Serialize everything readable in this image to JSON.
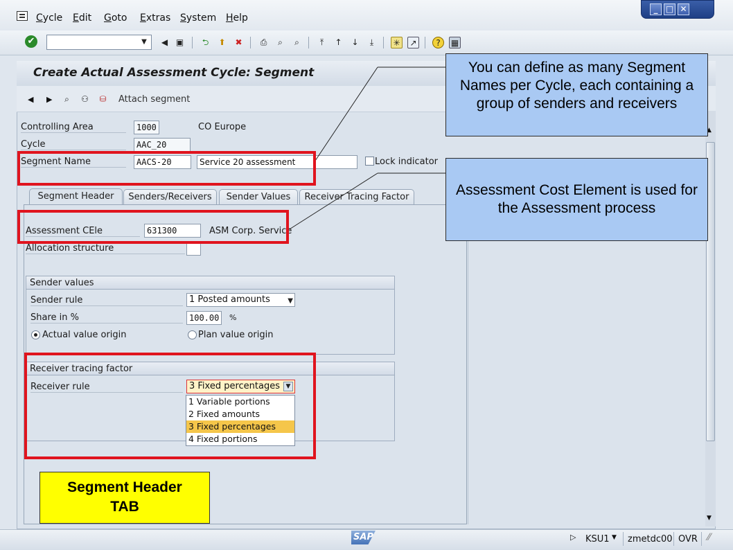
{
  "menubar": {
    "items": [
      "Cycle",
      "Edit",
      "Goto",
      "Extras",
      "System",
      "Help"
    ]
  },
  "window_controls": [
    "_",
    "□",
    "✕"
  ],
  "toolbar": {
    "command_field_value": ""
  },
  "page": {
    "title": "Create Actual Assessment Cycle: Segment",
    "attach_segment": "Attach segment"
  },
  "header_fields": {
    "controlling_area": {
      "label": "Controlling Area",
      "value": "1000",
      "text": "CO Europe"
    },
    "cycle": {
      "label": "Cycle",
      "value": "AAC_20"
    },
    "segment_name": {
      "label": "Segment Name",
      "value": "AACS-20",
      "description": "Service 20 assessment"
    },
    "lock_indicator": {
      "label": "Lock indicator",
      "checked": false
    }
  },
  "tabs": [
    {
      "label": "Segment Header",
      "active": true
    },
    {
      "label": "Senders/Receivers",
      "active": false
    },
    {
      "label": "Sender Values",
      "active": false
    },
    {
      "label": "Receiver Tracing Factor",
      "active": false
    }
  ],
  "segment_header": {
    "assessment_cele": {
      "label": "Assessment CEle",
      "value": "631300",
      "text": "ASM Corp. Service"
    },
    "allocation_structure": {
      "label": "Allocation structure",
      "value": ""
    }
  },
  "sender_values": {
    "title": "Sender values",
    "sender_rule": {
      "label": "Sender rule",
      "value": "1 Posted amounts"
    },
    "share": {
      "label": "Share in %",
      "value": "100.00",
      "unit": "%"
    },
    "origin_actual": {
      "label": "Actual value origin",
      "selected": true
    },
    "origin_plan": {
      "label": "Plan value origin",
      "selected": false
    }
  },
  "receiver_tracing": {
    "title": "Receiver tracing factor",
    "receiver_rule": {
      "label": "Receiver rule",
      "value": "3 Fixed percentages"
    },
    "options": [
      "1 Variable portions",
      "2 Fixed amounts",
      "3 Fixed percentages",
      "4 Fixed portions"
    ],
    "selected_index": 2
  },
  "callouts": {
    "segment_names": "You can define as many Segment Names per Cycle, each containing a group of senders and receivers",
    "cost_element": "Assessment Cost Element is used for the Assessment process",
    "tab_note": "Segment Header TAB"
  },
  "status_bar": {
    "logo": "SAP",
    "transaction": "KSU1",
    "server": "zmetdc00",
    "mode": "OVR"
  },
  "colors": {
    "annotation_red": "#e0141e",
    "callout_blue": "#a9c9f3",
    "callout_yellow": "#ffff00",
    "selected_option": "#f5c64a"
  }
}
